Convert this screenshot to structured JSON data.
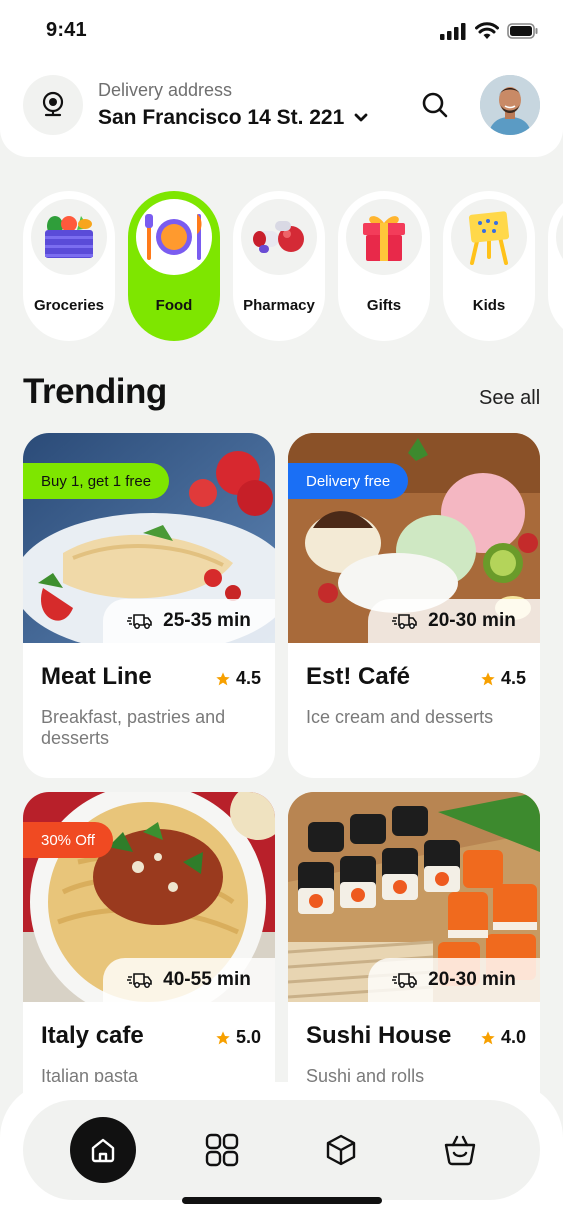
{
  "status_bar": {
    "time": "9:41"
  },
  "header": {
    "address_label": "Delivery address",
    "address_value": "San Francisco 14 St. 221",
    "location_icon": "location-pin-icon",
    "search_icon": "search-icon"
  },
  "categories": [
    {
      "label": "Groceries",
      "icon": "grocery-crate-icon",
      "active": false
    },
    {
      "label": "Food",
      "icon": "plate-cutlery-icon",
      "active": true
    },
    {
      "label": "Pharmacy",
      "icon": "pills-icon",
      "active": false
    },
    {
      "label": "Gifts",
      "icon": "gift-box-icon",
      "active": false
    },
    {
      "label": "Kids",
      "icon": "kids-easel-icon",
      "active": false
    }
  ],
  "trending": {
    "title": "Trending",
    "see_all": "See all",
    "cards": [
      {
        "badge": "Buy 1, get 1 free",
        "badge_color": "#7ee600",
        "time": "25-35 min",
        "name": "Meat Line",
        "rating": "4.5",
        "desc": "Breakfast, pastries and desserts"
      },
      {
        "badge": "Delivery free",
        "badge_color": "#1a6ff5",
        "time": "20-30 min",
        "name": "Est! Café",
        "rating": "4.5",
        "desc": "Ice cream and desserts"
      },
      {
        "badge": "30% Off",
        "badge_color": "#f04a22",
        "time": "40-55 min",
        "name": "Italy cafe",
        "rating": "5.0",
        "desc": "Italian pasta"
      },
      {
        "badge": "",
        "badge_color": "",
        "time": "20-30 min",
        "name": "Sushi House",
        "rating": "4.0",
        "desc": "Sushi and rolls"
      }
    ]
  },
  "bottom_nav": {
    "items": [
      "home-icon",
      "grid-icon",
      "box-icon",
      "basket-icon"
    ],
    "active": "home-icon"
  },
  "colors": {
    "accent": "#7ee600",
    "background": "#f2f3f1",
    "star": "#f7a000"
  }
}
